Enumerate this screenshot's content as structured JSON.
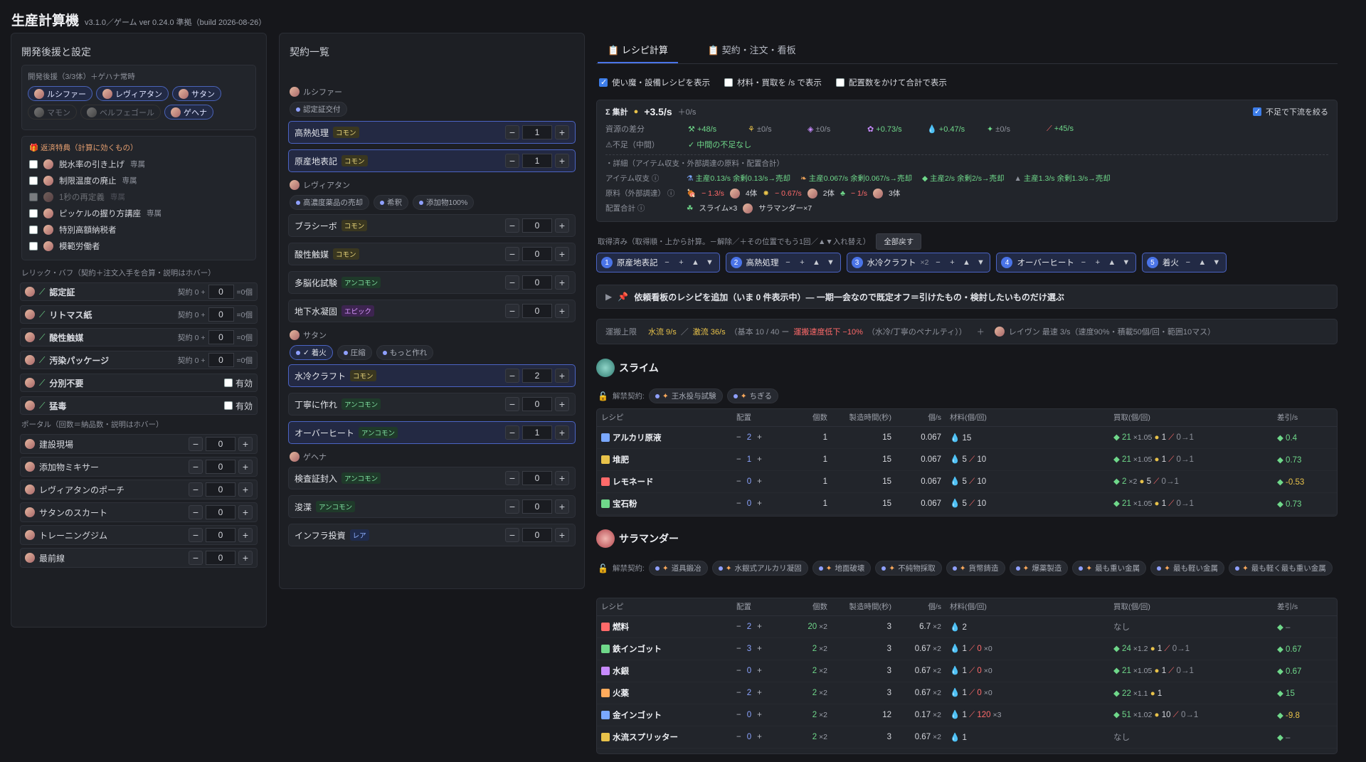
{
  "app": {
    "title": "生産計算機",
    "version": "v3.1.0／ゲーム ver 0.24.0 準拠（build 2026-08-26）"
  },
  "left": {
    "title": "開発後援と設定",
    "backers_label": "開発後援（3/3体）＋ゲハナ常時",
    "backers": [
      {
        "label": "ルシファー",
        "on": true
      },
      {
        "label": "レヴィアタン",
        "on": true
      },
      {
        "label": "サタン",
        "on": true
      },
      {
        "label": "マモン",
        "on": false
      },
      {
        "label": "ベルフェゴール",
        "on": false
      },
      {
        "label": "ゲヘナ",
        "on": true
      }
    ],
    "perks_title": "返済特典（計算に効くもの）",
    "perks": [
      {
        "label": "脱水率の引き上げ",
        "tag": "専属"
      },
      {
        "label": "制限温度の廃止",
        "tag": "専属"
      },
      {
        "label": "1秒の再定義",
        "tag": "専属",
        "disabled": true
      },
      {
        "label": "ピッケルの握り方講座",
        "tag": "専属"
      },
      {
        "label": "特別高額納税者",
        "tag": ""
      },
      {
        "label": "模範労働者",
        "tag": ""
      }
    ],
    "relic_title": "レリック・バフ（契約＋注文入手を合算・説明はホバー）",
    "relics": [
      {
        "label": "認定証",
        "pre": "契約 0 +",
        "val": "0",
        "post": "=0個"
      },
      {
        "label": "リトマス紙",
        "pre": "契約 0 +",
        "val": "0",
        "post": "=0個"
      },
      {
        "label": "酸性触媒",
        "pre": "契約 0 +",
        "val": "0",
        "post": "=0個"
      },
      {
        "label": "汚染パッケージ",
        "pre": "契約 0 +",
        "val": "0",
        "post": "=0個"
      },
      {
        "label": "分別不要",
        "check": "有効"
      },
      {
        "label": "猛毒",
        "check": "有効"
      }
    ],
    "portal_title": "ポータル（回数＝納品数・説明はホバー）",
    "portals": [
      {
        "label": "建設現場",
        "val": "0"
      },
      {
        "label": "添加物ミキサー",
        "val": "0"
      },
      {
        "label": "レヴィアタンのポーチ",
        "val": "0"
      },
      {
        "label": "サタンのスカート",
        "val": "0"
      },
      {
        "label": "トレーニングジム",
        "val": "0"
      },
      {
        "label": "最前線",
        "val": "0"
      }
    ]
  },
  "contracts": {
    "title": "契約一覧",
    "groups": [
      {
        "name": "ルシファー",
        "pills": [
          "認定証交付"
        ],
        "items": [
          {
            "label": "高熱処理",
            "tag": "コモン",
            "t": "c",
            "val": "1",
            "hl": true
          },
          {
            "label": "原産地表記",
            "tag": "コモン",
            "t": "c",
            "val": "1",
            "hl": true
          }
        ]
      },
      {
        "name": "レヴィアタン",
        "pills": [
          "高濃度薬品の売却",
          "希釈",
          "添加物100%"
        ],
        "items": [
          {
            "label": "ブラシーボ",
            "tag": "コモン",
            "t": "c",
            "val": "0"
          },
          {
            "label": "酸性触媒",
            "tag": "コモン",
            "t": "c",
            "val": "0"
          },
          {
            "label": "多脳化試験",
            "tag": "アンコモン",
            "t": "u",
            "val": "0"
          },
          {
            "label": "地下水凝固",
            "tag": "エピック",
            "t": "e",
            "val": "0"
          }
        ]
      },
      {
        "name": "サタン",
        "pills": [
          "✓ 着火",
          "圧縮",
          "もっと作れ"
        ],
        "items": [
          {
            "label": "水冷クラフト",
            "tag": "コモン",
            "t": "c",
            "val": "2",
            "hl": true
          },
          {
            "label": "丁寧に作れ",
            "tag": "アンコモン",
            "t": "u",
            "val": "0"
          },
          {
            "label": "オーバーヒート",
            "tag": "アンコモン",
            "t": "u",
            "val": "1",
            "hl": true
          }
        ]
      },
      {
        "name": "ゲヘナ",
        "pills": [],
        "items": [
          {
            "label": "検査証封入",
            "tag": "アンコモン",
            "t": "u",
            "val": "0"
          },
          {
            "label": "浚渫",
            "tag": "アンコモン",
            "t": "u",
            "val": "0"
          },
          {
            "label": "インフラ投資",
            "tag": "レア",
            "t": "r",
            "val": "0"
          }
        ]
      }
    ]
  },
  "main": {
    "tabs": [
      "レシピ計算",
      "契約・注文・看板"
    ],
    "opts": [
      "使い魔・設備レシピを表示",
      "材料・買取を /s で表示",
      "配置数をかけて合計で表示"
    ],
    "sum": {
      "label": "Σ 集計",
      "gold": "+3.5/s",
      "sub": "＋0/s",
      "fix": "不足で下流を絞る",
      "res_label": "資源の差分",
      "res": [
        "+48/s",
        "±0/s",
        "±0/s",
        "+0.73/s",
        "+0.47/s",
        "±0/s",
        "+45/s"
      ],
      "short_label": "⚠不足（中間）",
      "short": "✓ 中間の不足なし",
      "detail": "・詳細（アイテム収支・外部調達の原料・配置合計）",
      "items_label": "アイテム収支",
      "items": [
        "主産0.13/s 余剰0.13/s→売却",
        "主産0.067/s 余剰0.067/s→売却",
        "主産2/s 余剰2/s→売却",
        "主産1.3/s 余剰1.3/s→売却"
      ],
      "raw_label": "原料（外部調達）",
      "raw": [
        "− 1.3/s",
        "4体",
        "− 0.67/s",
        "2体",
        "− 1/s",
        "3体"
      ],
      "place_label": "配置合計",
      "place": [
        "スライム×3",
        "サラマンダー×7"
      ]
    },
    "queue_label": "取得済み（取得順・上から計算。－解除／＋その位置でもう1回／▲▼入れ替え）",
    "reset": "全部戻す",
    "queue": [
      {
        "n": "1",
        "label": "原産地表記"
      },
      {
        "n": "2",
        "label": "高熱処理"
      },
      {
        "n": "3",
        "label": "水冷クラフト",
        "x": "×2"
      },
      {
        "n": "4",
        "label": "オーバーヒート"
      },
      {
        "n": "5",
        "label": "着火"
      }
    ],
    "request": "依頼看板のレシピを追加（いま 0 件表示中）— 一期一会なので既定オフ＝引けたもの・検討したいものだけ選ぶ",
    "transport": {
      "label": "運搬上限",
      "a": "水流 9/s",
      "b": "激流 36/s",
      "c": "（基本 10 / 40 ー",
      "d": "運搬速度低下 −10%",
      "e": "（水冷/丁寧のペナルティ））",
      "f": "レイヴン 最速 3/s（速度90%・積載50個/回・範囲10マス）"
    },
    "slime": {
      "name": "スライム",
      "unlock": "解禁契約:",
      "pills": [
        "王水投与試験",
        "ちぎる"
      ],
      "cols": [
        "レシピ",
        "配置",
        "個数",
        "製造時間(秒)",
        "個/s",
        "材料(個/回)",
        "買取(個/回)",
        "差引/s"
      ],
      "rows": [
        {
          "n": "アルカリ原液",
          "p": "2",
          "c": "1",
          "t": "15",
          "s": "0.067",
          "m": "15",
          "buy": "21",
          "bx": "×1.05",
          "g": "1",
          "b2": "0→1",
          "d": "0.4"
        },
        {
          "n": "堆肥",
          "p": "1",
          "c": "1",
          "t": "15",
          "s": "0.067",
          "m": "5",
          "m2": "10",
          "buy": "21",
          "bx": "×1.05",
          "g": "1",
          "b2": "0→1",
          "d": "0.73"
        },
        {
          "n": "レモネード",
          "p": "0",
          "c": "1",
          "t": "15",
          "s": "0.067",
          "m": "5",
          "m2": "10",
          "buy": "2",
          "bx": "×2",
          "g": "5",
          "b2": "0→1",
          "d": "-0.53"
        },
        {
          "n": "宝石粉",
          "p": "0",
          "c": "1",
          "t": "15",
          "s": "0.067",
          "m": "5",
          "m2": "10",
          "buy": "21",
          "bx": "×1.05",
          "g": "1",
          "b2": "0→1",
          "d": "0.73"
        }
      ]
    },
    "sala": {
      "name": "サラマンダー",
      "unlock": "解禁契約:",
      "pills": [
        "道具鍛冶",
        "水銀式アルカリ凝固",
        "地面破壊",
        "不純物採取",
        "貨幣鋳造",
        "爆薬製造",
        "最も重い金属",
        "最も軽い金属",
        "最も軽く最も重い金属"
      ],
      "rows": [
        {
          "n": "燃料",
          "p": "2",
          "c": "20",
          "cx": "×2",
          "t": "3",
          "s": "6.7",
          "sx": "×2",
          "m": "2",
          "buy": "なし",
          "d": "–"
        },
        {
          "n": "鉄インゴット",
          "p": "3",
          "c": "2",
          "cx": "×2",
          "t": "3",
          "s": "0.67",
          "sx": "×2",
          "m": "1",
          "m2": "0",
          "mx": "×0",
          "buy": "24",
          "bx": "×1.2",
          "g": "1",
          "b2": "0→1",
          "d": "0.67"
        },
        {
          "n": "水銀",
          "p": "0",
          "c": "2",
          "cx": "×2",
          "t": "3",
          "s": "0.67",
          "sx": "×2",
          "m": "1",
          "m2": "0",
          "mx": "×0",
          "buy": "21",
          "bx": "×1.05",
          "g": "1",
          "b2": "0→1",
          "d": "0.67"
        },
        {
          "n": "火薬",
          "p": "2",
          "c": "2",
          "cx": "×2",
          "t": "3",
          "s": "0.67",
          "sx": "×2",
          "m": "1",
          "m2": "0",
          "mx": "×0",
          "buy": "22",
          "bx": "×1.1",
          "g": "1",
          "b2": "",
          "d": "15"
        },
        {
          "n": "金インゴット",
          "p": "0",
          "c": "2",
          "cx": "×2",
          "t": "12",
          "s": "0.17",
          "sx": "×2",
          "m": "1",
          "m2": "120",
          "mx": "×3",
          "buy": "51",
          "bx": "×1.02",
          "g": "10",
          "b2": "0→1",
          "d": "-9.8"
        },
        {
          "n": "水流スプリッター",
          "p": "0",
          "c": "2",
          "cx": "×2",
          "t": "3",
          "s": "0.67",
          "sx": "×2",
          "m": "1",
          "buy": "なし",
          "d": "–"
        }
      ]
    }
  }
}
